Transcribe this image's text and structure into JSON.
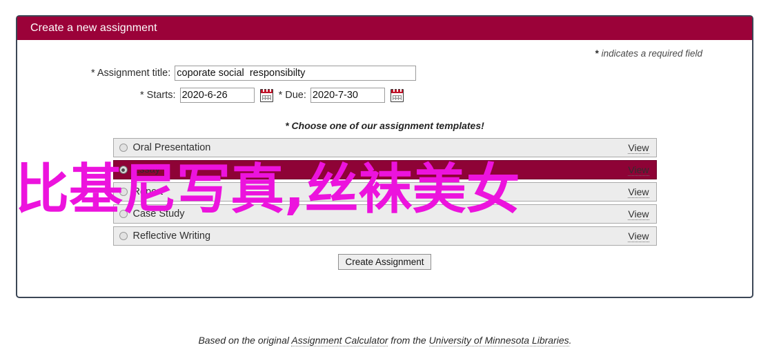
{
  "panel": {
    "title": "Create a new assignment",
    "required_note": "indicates a required field",
    "required_star": "*"
  },
  "form": {
    "title_label": "* Assignment title:",
    "title_value": "coporate social  responsibilty",
    "title_placeholder": "",
    "starts_label": "* Starts:",
    "starts_value": "2020-6-26",
    "due_label": "* Due:",
    "due_value": "2020-7-30",
    "starts_calendar_icon": "calendar-icon",
    "due_calendar_icon": "calendar-icon"
  },
  "templates": {
    "heading": "* Choose one of our assignment templates!",
    "view_label": "View",
    "items": [
      {
        "label": "Oral Presentation",
        "selected": false,
        "view": "View"
      },
      {
        "label": "Essay",
        "selected": true,
        "view": "View"
      },
      {
        "label": "Report",
        "selected": false,
        "view": "View"
      },
      {
        "label": "Case Study",
        "selected": false,
        "view": "View"
      },
      {
        "label": "Reflective Writing",
        "selected": false,
        "view": "View"
      }
    ]
  },
  "actions": {
    "create_label": "Create Assignment"
  },
  "footer": {
    "prefix": "Based on the original ",
    "link1": "Assignment Calculator",
    "middle": " from the ",
    "link2": "University of Minnesota Libraries",
    "suffix": "."
  },
  "watermark": {
    "text": "比基尼写真,丝袜美女"
  },
  "colors": {
    "header_bg": "#9b0239",
    "panel_border": "#3b4655",
    "selected_row": "#8e0336",
    "row_bg": "#ececec",
    "watermark": "#ec13dd"
  }
}
